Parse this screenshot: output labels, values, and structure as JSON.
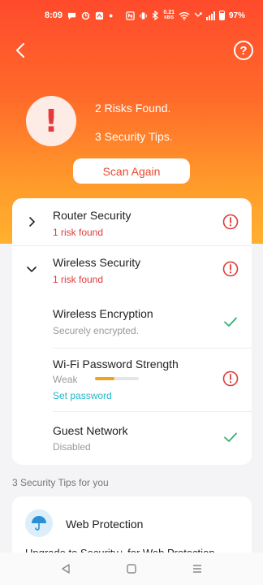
{
  "status_bar": {
    "time": "8:09",
    "net_speed": "0.21",
    "net_unit": "KB/S",
    "battery": "97%"
  },
  "header": {
    "back_icon": "chevron-left-icon",
    "help_icon": "question-circle-icon",
    "help_glyph": "?",
    "alert_icon": "exclamation-icon",
    "alert_glyph": "!",
    "risks_found": "2 Risks Found.",
    "security_tips": "3 Security Tips.",
    "scan_again_label": "Scan Again"
  },
  "sections": [
    {
      "title": "Router Security",
      "subtitle": "1 risk found",
      "expanded": false,
      "status": "risk"
    },
    {
      "title": "Wireless Security",
      "subtitle": "1 risk found",
      "expanded": true,
      "status": "risk",
      "items": [
        {
          "title": "Wireless Encryption",
          "subtitle": "Securely encrypted.",
          "status": "ok"
        },
        {
          "title": "Wi-Fi Password Strength",
          "subtitle": "Weak",
          "strength_fraction": 0.45,
          "action": "Set password",
          "status": "risk"
        },
        {
          "title": "Guest Network",
          "subtitle": "Disabled",
          "status": "ok"
        }
      ]
    }
  ],
  "tips": {
    "heading": "3 Security Tips for you",
    "items": [
      {
        "icon": "umbrella-icon",
        "title": "Web Protection",
        "description": "Upgrade to Security+ for Web Protection"
      }
    ]
  },
  "colors": {
    "accent": "#ff5a2a",
    "risk": "#e03a3a",
    "ok": "#2fb36b",
    "link": "#22b7c9",
    "strength_weak": "#f3a21b"
  },
  "nav": {
    "back_icon": "triangle-back-icon",
    "home_icon": "square-home-icon",
    "menu_icon": "menu-lines-icon"
  }
}
